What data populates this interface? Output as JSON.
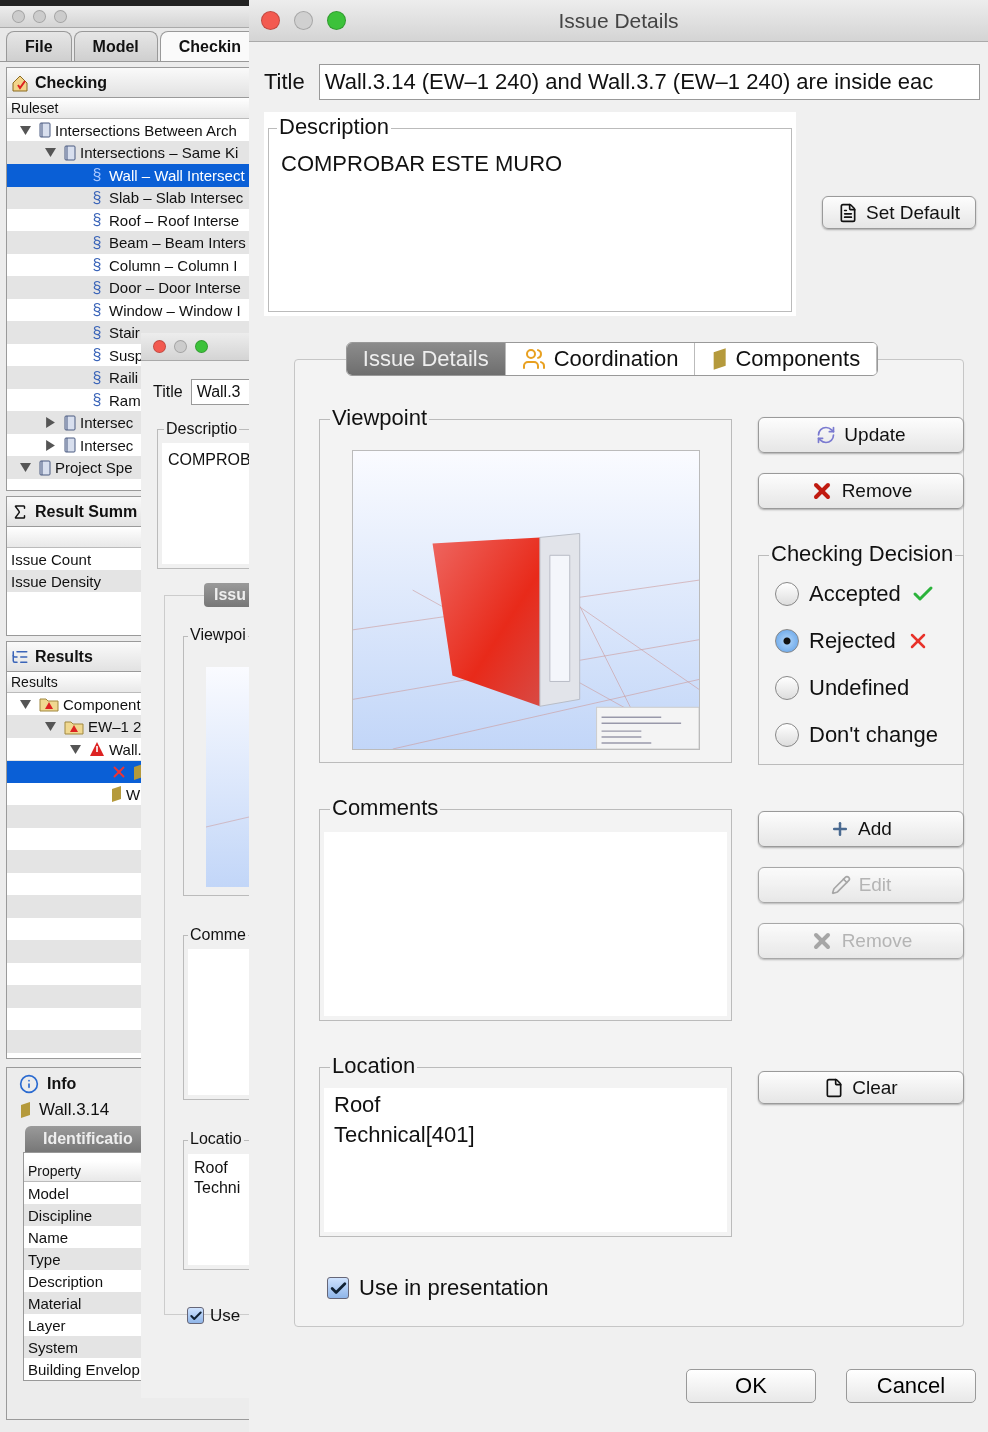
{
  "main_window": {
    "tabs": [
      {
        "label": "File",
        "selected": false
      },
      {
        "label": "Model",
        "selected": false
      },
      {
        "label": "Checkin",
        "selected": true
      }
    ],
    "checking": {
      "title": "Checking",
      "column": "Ruleset",
      "tree": [
        {
          "label": "Intersections Between Arch",
          "kind": "ruleset",
          "expanded": true,
          "selected": false,
          "children": [
            {
              "label": "Intersections – Same Ki",
              "kind": "ruleset",
              "expanded": true,
              "selected": false,
              "children": [
                {
                  "label": "Wall – Wall Intersect",
                  "kind": "rule",
                  "symbol": "§",
                  "selected": true
                },
                {
                  "label": "Slab – Slab Intersec",
                  "kind": "rule",
                  "symbol": "§",
                  "selected": false
                },
                {
                  "label": "Roof – Roof Interse",
                  "kind": "rule",
                  "symbol": "§",
                  "selected": false
                },
                {
                  "label": "Beam – Beam Inters",
                  "kind": "rule",
                  "symbol": "§",
                  "selected": false
                },
                {
                  "label": "Column – Column I",
                  "kind": "rule",
                  "symbol": "§",
                  "selected": false
                },
                {
                  "label": "Door – Door Interse",
                  "kind": "rule",
                  "symbol": "§",
                  "selected": false
                },
                {
                  "label": "Window – Window I",
                  "kind": "rule",
                  "symbol": "§",
                  "selected": false
                },
                {
                  "label": "Stair",
                  "kind": "rule",
                  "symbol": "§",
                  "selected": false
                },
                {
                  "label": "Susp",
                  "kind": "rule",
                  "symbol": "§",
                  "selected": false
                },
                {
                  "label": "Raili",
                  "kind": "rule",
                  "symbol": "§",
                  "selected": false
                },
                {
                  "label": "Ram",
                  "kind": "rule",
                  "symbol": "§",
                  "selected": false
                }
              ]
            },
            {
              "label": "Intersec",
              "kind": "ruleset",
              "expanded": false,
              "selected": false
            },
            {
              "label": "Intersec",
              "kind": "ruleset",
              "expanded": false,
              "selected": false
            }
          ]
        },
        {
          "label": "Project Spe",
          "kind": "ruleset",
          "expanded": true,
          "selected": false
        }
      ]
    },
    "result_summary": {
      "title": "Result Summ",
      "rows": [
        "Issue Count",
        "Issue Density"
      ]
    },
    "results": {
      "title": "Results",
      "column": "Results",
      "tree": [
        {
          "label": "Component",
          "kind": "issue-folder",
          "expanded": true,
          "selected": false,
          "children": [
            {
              "label": "EW–1 2",
              "kind": "issue-folder",
              "expanded": true,
              "selected": false,
              "children": [
                {
                  "label": "Wall.",
                  "kind": "warning",
                  "expanded": true,
                  "selected": false,
                  "children": [
                    {
                      "kind": "rejected-component",
                      "selected": true
                    },
                    {
                      "label": "W",
                      "kind": "component",
                      "selected": false
                    }
                  ]
                }
              ]
            }
          ]
        }
      ]
    },
    "info": {
      "title": "Info",
      "item": "Wall.3.14",
      "tab": "Identificatio",
      "table": {
        "column": "Property",
        "rows": [
          "Model",
          "Discipline",
          "Name",
          "Type",
          "Description",
          "Material",
          "Layer",
          "System",
          "Building Envelop"
        ]
      }
    }
  },
  "middle_dialog": {
    "title_label": "Title",
    "title_value": "Wall.3",
    "description_label": "Descriptio",
    "description": "COMPROB",
    "tab": "Issu",
    "viewpoint_label": "Viewpoi",
    "comments_label": "Comme",
    "location_label": "Locatio",
    "location_lines": [
      "Roof",
      "Techni"
    ],
    "use_in_presentation": {
      "label": "Use",
      "checked": true
    }
  },
  "dialog": {
    "title": "Issue Details",
    "title_label": "Title",
    "title_value": "Wall.3.14 (EW–1 240) and Wall.3.7 (EW–1 240) are inside eac",
    "description_label": "Description",
    "description": "COMPROBAR ESTE MURO",
    "set_default": "Set Default",
    "tabs": [
      {
        "label": "Issue Details",
        "kind": "details",
        "selected": true
      },
      {
        "label": "Coordination",
        "kind": "coordination",
        "selected": false
      },
      {
        "label": "Components",
        "kind": "components",
        "selected": false
      }
    ],
    "viewpoint": {
      "label": "Viewpoint",
      "buttons": [
        {
          "label": "Update",
          "kind": "update"
        },
        {
          "label": "Remove",
          "kind": "remove"
        }
      ]
    },
    "decision": {
      "label": "Checking Decision",
      "options": [
        {
          "label": "Accepted",
          "kind": "accepted",
          "selected": false
        },
        {
          "label": "Rejected",
          "kind": "rejected",
          "selected": true
        },
        {
          "label": "Undefined",
          "kind": "undefined",
          "selected": false
        },
        {
          "label": "Don't change",
          "kind": "unchanged",
          "selected": false
        }
      ]
    },
    "comments": {
      "label": "Comments",
      "buttons": [
        {
          "label": "Add",
          "kind": "add",
          "disabled": false
        },
        {
          "label": "Edit",
          "kind": "edit",
          "disabled": true
        },
        {
          "label": "Remove",
          "kind": "remove",
          "disabled": true
        }
      ]
    },
    "location": {
      "label": "Location",
      "lines": [
        "Roof",
        "Technical[401]"
      ],
      "clear": "Clear"
    },
    "use_in_presentation": {
      "label": "Use in presentation",
      "checked": true
    },
    "buttons": [
      "OK",
      "Cancel"
    ]
  }
}
